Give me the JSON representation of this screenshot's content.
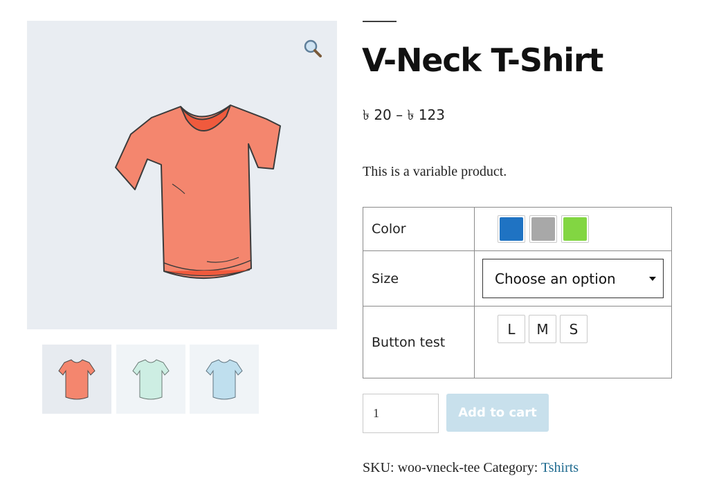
{
  "product": {
    "title": "V-Neck T-Shirt",
    "price": "৳ 20 – ৳ 123",
    "description": "This is a variable product."
  },
  "gallery": {
    "zoom_icon": "magnifier-icon",
    "main_image_color": "#f4866e",
    "thumbnails": [
      {
        "color": "#f4866e"
      },
      {
        "color": "#cdeee3"
      },
      {
        "color": "#bfdfee"
      }
    ]
  },
  "variations": {
    "color": {
      "label": "Color",
      "swatches": [
        {
          "name": "Blue",
          "hex": "#1f73c3"
        },
        {
          "name": "Gray",
          "hex": "#a8a8a8"
        },
        {
          "name": "Green",
          "hex": "#82d642"
        }
      ]
    },
    "size": {
      "label": "Size",
      "selected": "Choose an option"
    },
    "button_test": {
      "label": "Button test",
      "options": [
        "L",
        "M",
        "S"
      ]
    }
  },
  "cart": {
    "quantity": "1",
    "add_label": "Add to cart"
  },
  "meta": {
    "sku_label": "SKU:",
    "sku": "woo-vneck-tee",
    "category_label": "Category:",
    "category": "Tshirts"
  }
}
